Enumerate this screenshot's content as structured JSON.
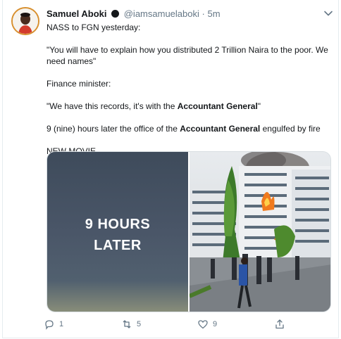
{
  "tweet": {
    "author_name": "Samuel Aboki",
    "handle": "@iamsamuelaboki",
    "separator": "·",
    "time": "5m",
    "lines": [
      "NASS to FGN yesterday:",
      "\"You will have to explain how you distributed 2 Trillion Naira to the poor. We need names\"",
      "Finance minister:"
    ],
    "quote_before": "\"We have this records, it's with the ",
    "quote_bold": "Accountant General",
    "quote_after": "\"",
    "fire_before": "9 (nine) hours later the office of the ",
    "fire_bold": "Accountant General",
    "fire_after": " engulfed by fire",
    "closing": "NEW MOVIE"
  },
  "media": {
    "left_caption_line1": "9 HOURS",
    "left_caption_line2": "LATER"
  },
  "actions": {
    "reply_count": "1",
    "retweet_count": "5",
    "like_count": "9"
  },
  "colors": {
    "text": "#14171a",
    "muted": "#657786",
    "border": "#e6ecf0"
  }
}
